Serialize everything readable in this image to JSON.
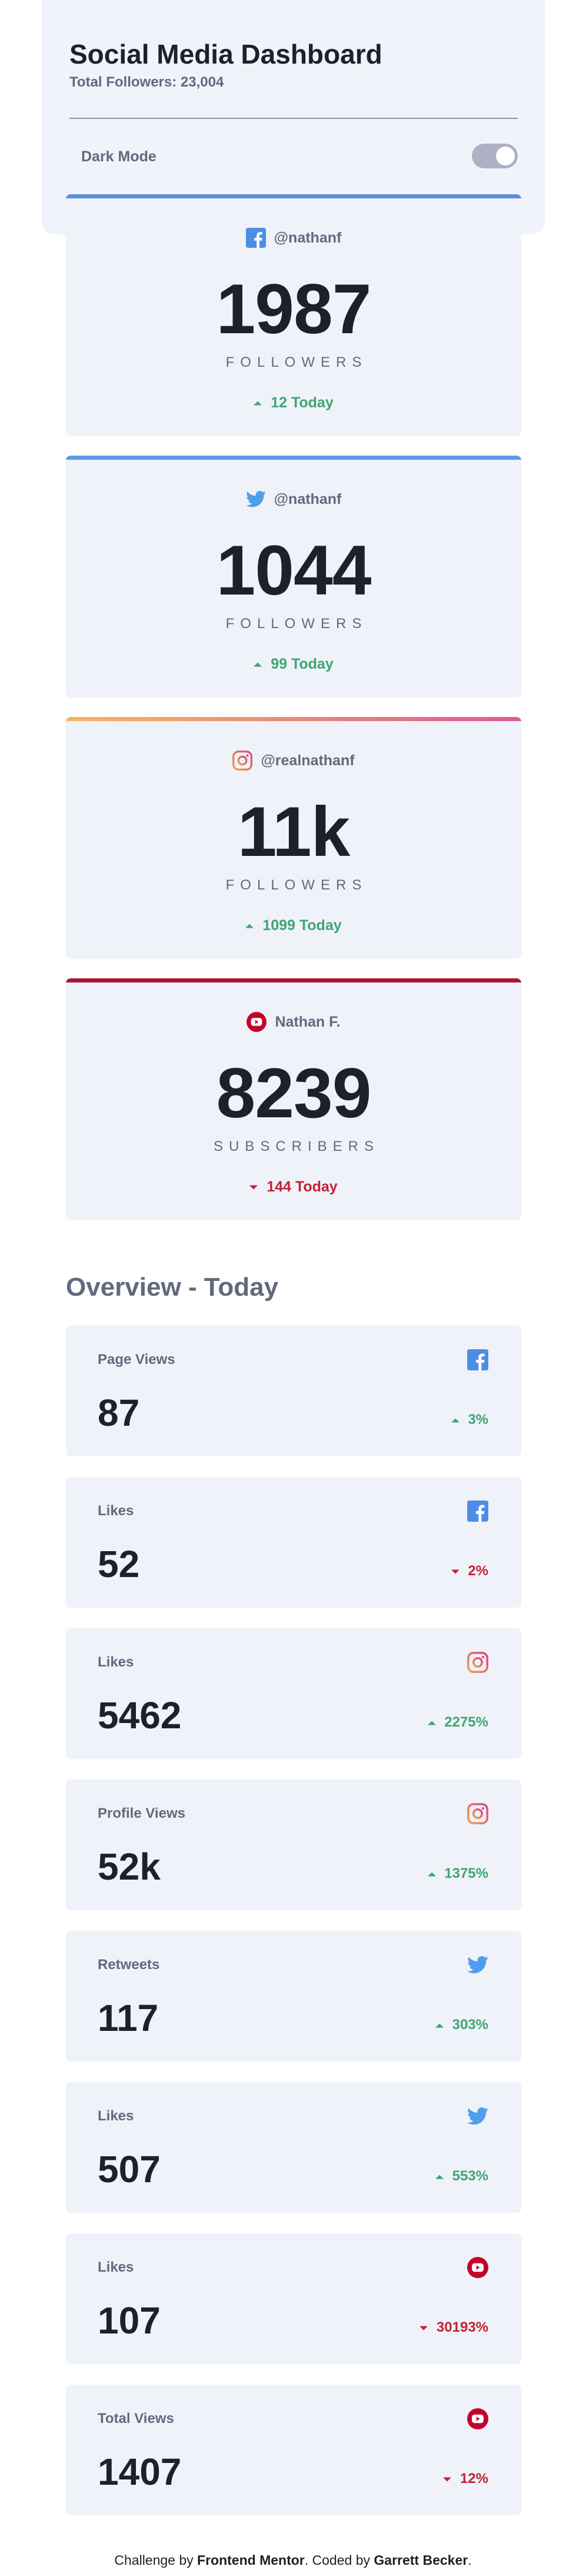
{
  "header": {
    "title": "Social Media Dashboard",
    "total_followers": "Total Followers: 23,004",
    "dark_mode_label": "Dark Mode"
  },
  "cards": [
    {
      "platform": "facebook",
      "icon": "facebook-icon",
      "handle": "@nathanf",
      "count": "1987",
      "unit": "FOLLOWERS",
      "change": "12 Today",
      "trend": "up"
    },
    {
      "platform": "twitter",
      "icon": "twitter-icon",
      "handle": "@nathanf",
      "count": "1044",
      "unit": "FOLLOWERS",
      "change": "99 Today",
      "trend": "up"
    },
    {
      "platform": "instagram",
      "icon": "instagram-icon",
      "handle": "@realnathanf",
      "count": "11k",
      "unit": "FOLLOWERS",
      "change": "1099 Today",
      "trend": "up"
    },
    {
      "platform": "youtube",
      "icon": "youtube-icon",
      "handle": "Nathan F.",
      "count": "8239",
      "unit": "SUBSCRIBERS",
      "change": "144 Today",
      "trend": "down"
    }
  ],
  "overview": {
    "title": "Overview - Today",
    "items": [
      {
        "label": "Page Views",
        "platform": "facebook",
        "value": "87",
        "change": "3%",
        "trend": "up"
      },
      {
        "label": "Likes",
        "platform": "facebook",
        "value": "52",
        "change": "2%",
        "trend": "down"
      },
      {
        "label": "Likes",
        "platform": "instagram",
        "value": "5462",
        "change": "2275%",
        "trend": "up"
      },
      {
        "label": "Profile Views",
        "platform": "instagram",
        "value": "52k",
        "change": "1375%",
        "trend": "up"
      },
      {
        "label": "Retweets",
        "platform": "twitter",
        "value": "117",
        "change": "303%",
        "trend": "up"
      },
      {
        "label": "Likes",
        "platform": "twitter",
        "value": "507",
        "change": "553%",
        "trend": "up"
      },
      {
        "label": "Likes",
        "platform": "youtube",
        "value": "107",
        "change": "30193%",
        "trend": "down"
      },
      {
        "label": "Total Views",
        "platform": "youtube",
        "value": "1407",
        "change": "12%",
        "trend": "down"
      }
    ]
  },
  "footer": {
    "prefix": "Challenge by ",
    "challenge_by": "Frontend Mentor",
    "middle": ". Coded by ",
    "coded_by": "Garrett Becker",
    "suffix": "."
  },
  "colors": {
    "facebook": "#198ff5",
    "twitter": "#1ca0f2",
    "instagram_start": "#fdc468",
    "instagram_end": "#df4996",
    "youtube": "#c4032a",
    "up": "#3ea672",
    "down": "#c22337"
  }
}
